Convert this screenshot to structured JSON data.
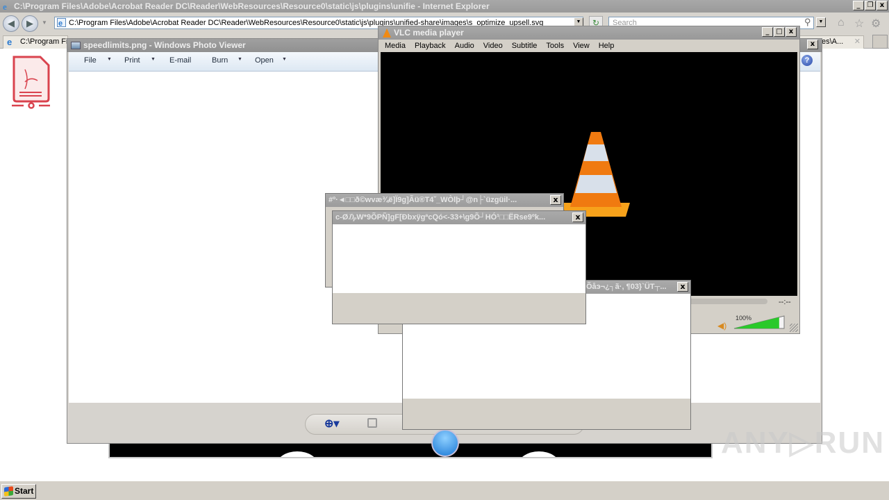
{
  "ie": {
    "title": "C:\\Program Files\\Adobe\\Acrobat Reader DC\\Reader\\WebResources\\Resource0\\static\\js\\plugins\\unifie - Internet Explorer",
    "address": "C:\\Program Files\\Adobe\\Acrobat Reader DC\\Reader\\WebResources\\Resource0\\static\\js\\plugins\\unified-share\\images\\s_optimize_upsell.svg",
    "search_placeholder": "Search",
    "tabs": [
      {
        "label": "C:\\Program Fil"
      },
      {
        "label": "es\\A..."
      }
    ],
    "window_buttons": [
      "_",
      "❐",
      "X"
    ]
  },
  "photo_viewer": {
    "title": "speedlimits.png - Windows Photo Viewer",
    "menu": [
      {
        "label": "File",
        "has_dropdown": true
      },
      {
        "label": "Print",
        "has_dropdown": true
      },
      {
        "label": "E-mail",
        "has_dropdown": false
      },
      {
        "label": "Burn",
        "has_dropdown": true
      },
      {
        "label": "Open",
        "has_dropdown": true
      }
    ],
    "help": "?"
  },
  "vlc": {
    "title": "VLC media player",
    "menu": [
      "Media",
      "Playback",
      "Audio",
      "Video",
      "Subtitle",
      "Tools",
      "View",
      "Help"
    ],
    "time": "--:--",
    "volume_label": "100%",
    "volume_fraction": 1.0
  },
  "dialogs": [
    {
      "title": "#º·◄□□ð©wvæ¾ë]Ï9g]Ãü®T4ˇ_WÒlþ┘@n├`üzgüil·..."
    },
    {
      "title": "c-Ø₯W*9ÕPÑ]gF[ÐbxÿgªcQó<-33+\\g9Õ┘HÓ¹□□ËRse9ºk..."
    },
    {
      "title": "Õåэ¬¿┐ã·, ¶03}`ÜT┬..."
    }
  ],
  "taskbar": {
    "start_label": "Start"
  },
  "watermark": "ANY▷RUN"
}
